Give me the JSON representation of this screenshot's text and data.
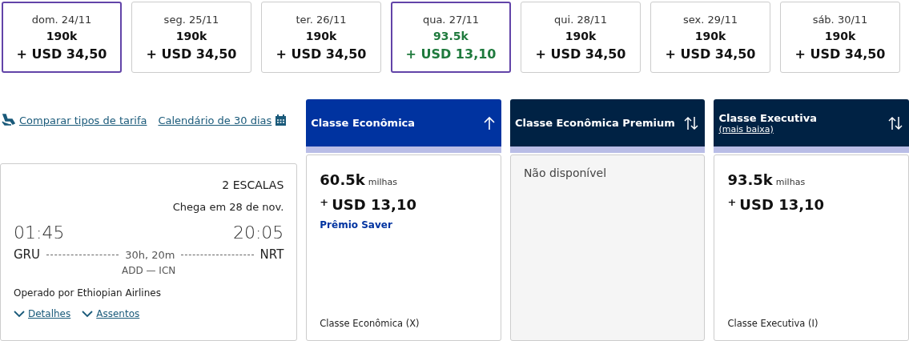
{
  "dates": [
    {
      "label": "dom. 24/11",
      "miles": "190k",
      "price": "+ USD 34,50",
      "outlined": true,
      "lowest": false
    },
    {
      "label": "seg. 25/11",
      "miles": "190k",
      "price": "+ USD 34,50",
      "outlined": false,
      "lowest": false
    },
    {
      "label": "ter. 26/11",
      "miles": "190k",
      "price": "+ USD 34,50",
      "outlined": false,
      "lowest": false
    },
    {
      "label": "qua. 27/11",
      "miles": "93.5k",
      "price": "+ USD 13,10",
      "outlined": true,
      "lowest": true
    },
    {
      "label": "qui. 28/11",
      "miles": "190k",
      "price": "+ USD 34,50",
      "outlined": false,
      "lowest": false
    },
    {
      "label": "sex. 29/11",
      "miles": "190k",
      "price": "+ USD 34,50",
      "outlined": false,
      "lowest": false
    },
    {
      "label": "sáb. 30/11",
      "miles": "190k",
      "price": "+ USD 34,50",
      "outlined": false,
      "lowest": false
    }
  ],
  "links": {
    "compare": "Comparar tipos de tarifa",
    "calendar": "Calendário de 30 dias"
  },
  "flight": {
    "stops": "2 ESCALAS",
    "arrival_note": "Chega em 28 de nov.",
    "depart_time": "01:45",
    "arrive_time": "20:05",
    "origin": "GRU",
    "destination": "NRT",
    "duration": "30h, 20m",
    "via": "ADD — ICN",
    "operator": "Operado por Ethiopian Airlines",
    "details_link": "Detalhes",
    "seats_link": "Assentos"
  },
  "classes": [
    {
      "title": "Classe Econômica",
      "selected": true,
      "sorted": true,
      "kind": "fare",
      "miles": "60.5k",
      "miles_unit": "milhas",
      "plus": "+",
      "price": "USD 13,10",
      "award": "Prêmio Saver",
      "fare_class": "Classe Econômica (X)"
    },
    {
      "title": "Classe Econômica Premium",
      "selected": false,
      "sorted": false,
      "kind": "unavailable",
      "message": "Não disponível"
    },
    {
      "title": "Classe Executiva",
      "subtitle_link": "(mais baixa)",
      "selected": false,
      "sorted": false,
      "kind": "fare",
      "miles": "93.5k",
      "miles_unit": "milhas",
      "plus": "+",
      "price": "USD 13,10",
      "fare_class": "Classe Executiva (I)"
    }
  ]
}
